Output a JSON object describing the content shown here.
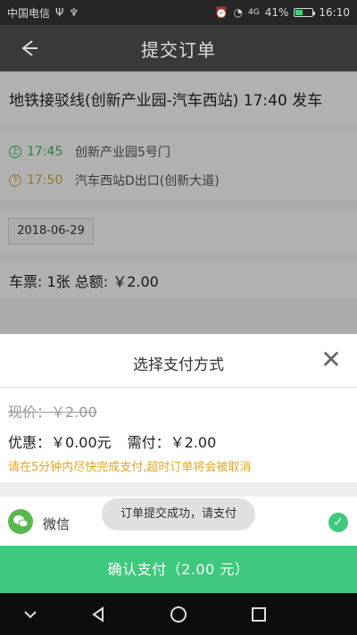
{
  "status_bar": {
    "carrier": "中国电信",
    "signal": "4G",
    "battery_percent": "41%",
    "battery_level": 0.41,
    "time": "16:10"
  },
  "titlebar": {
    "title": "提交订单",
    "back_icon": "back-arrow-icon"
  },
  "order": {
    "route_title": "地铁接驳线(创新产业园-汽车西站) 17:40 发车",
    "stops": [
      {
        "time": "17:45",
        "place": "创新产业园5号门",
        "icon": "board-icon",
        "color": "#3bb25d"
      },
      {
        "time": "17:50",
        "place": "汽车西站D出口(创新大道)",
        "icon": "alight-icon",
        "color": "#d3a23a"
      }
    ],
    "date": "2018-06-29",
    "tickets_text": "车票: 1张  总额: ￥2.00"
  },
  "payment_sheet": {
    "title": "选择支付方式",
    "close_icon": "close-icon",
    "original_price": "现价：￥2.00",
    "discount": "优惠：￥0.00元",
    "need_pay": "需付：￥2.00",
    "warning": "请在5分钟内尽快完成支付,超时订单将会被取消",
    "method": {
      "name": "微信",
      "icon": "wechat-icon",
      "selected": true
    },
    "confirm_button": "确认支付（2.00 元）"
  },
  "toast": {
    "message": "订单提交成功，请支付"
  },
  "colors": {
    "accent_green": "#3ec97e",
    "warning_orange": "#e6a520"
  },
  "navbar": {
    "buttons": [
      "chevron-down-icon",
      "back-triangle-icon",
      "home-circle-icon",
      "recents-square-icon"
    ]
  }
}
